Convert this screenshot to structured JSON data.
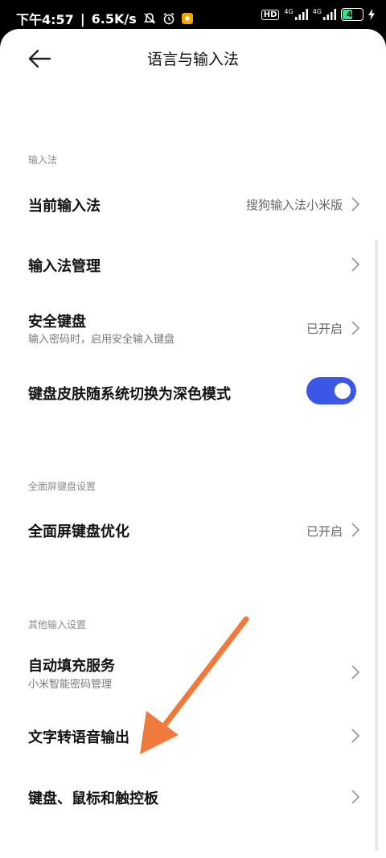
{
  "status": {
    "time": "下午4:57",
    "separator": "|",
    "speed": "6.5K/s",
    "hd": "HD",
    "net1": "4G",
    "net2": "4G",
    "battery": "41"
  },
  "header": {
    "title": "语言与输入法"
  },
  "sections": {
    "input_method": "输入法",
    "fullscreen": "全面屏键盘设置",
    "other": "其他输入设置"
  },
  "rows": {
    "current_ime": {
      "label": "当前输入法",
      "value": "搜狗输入法小米版"
    },
    "ime_manage": {
      "label": "输入法管理"
    },
    "secure_kb": {
      "label": "安全键盘",
      "sub": "输入密码时，启用安全输入键盘",
      "value": "已开启"
    },
    "dark_skin": {
      "label": "键盘皮肤随系统切换为深色模式",
      "toggle_on": true
    },
    "fs_opt": {
      "label": "全面屏键盘优化",
      "value": "已开启"
    },
    "autofill": {
      "label": "自动填充服务",
      "sub": "小米智能密码管理"
    },
    "tts": {
      "label": "文字转语音输出"
    },
    "kb_mouse": {
      "label": "键盘、鼠标和触控板"
    }
  },
  "colors": {
    "accent": "#3b57e6",
    "annotation_arrow": "#f07a3c"
  }
}
